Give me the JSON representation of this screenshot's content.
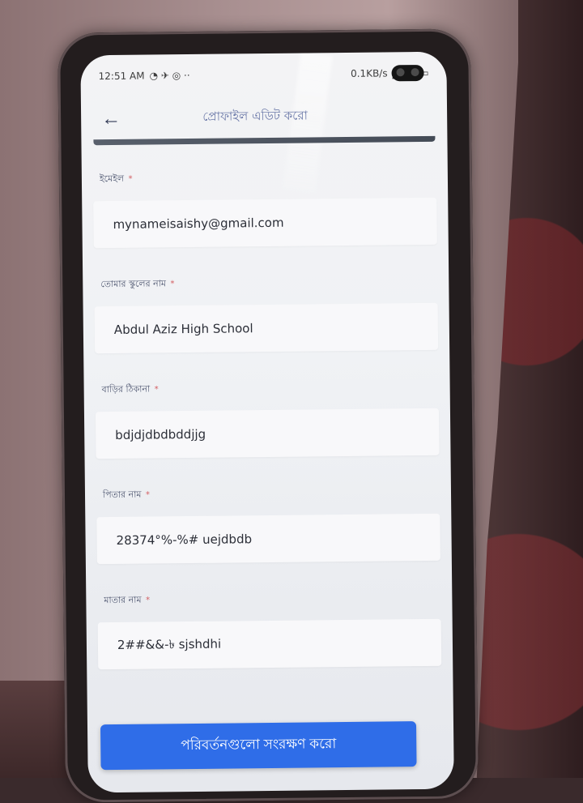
{
  "status_bar": {
    "time": "12:51 AM",
    "network_speed": "0.1KB/s"
  },
  "header": {
    "back_icon": "back-arrow-icon",
    "title": "প্রোফাইল এডিট করো"
  },
  "form": {
    "fields": [
      {
        "label": "ইমেইল",
        "required_mark": "*",
        "value": "mynameisaishy@gmail.com"
      },
      {
        "label": "তোমার স্কুলের নাম",
        "required_mark": "*",
        "value": "Abdul Aziz High School"
      },
      {
        "label": "বাড়ির ঠিকানা",
        "required_mark": "*",
        "value": "bdjdjdbdbddjjg"
      },
      {
        "label": "পিতার নাম",
        "required_mark": "*",
        "value": "28374°%-%# uejdbdb"
      },
      {
        "label": "মাতার নাম",
        "required_mark": "*",
        "value": "2##&&-৳ sjshdhi"
      }
    ]
  },
  "actions": {
    "save_label": "পরিবর্তনগুলো সংরক্ষণ করো"
  },
  "colors": {
    "primary": "#2f6de8",
    "background": "#f3f3f5",
    "title": "#6a78a8"
  }
}
